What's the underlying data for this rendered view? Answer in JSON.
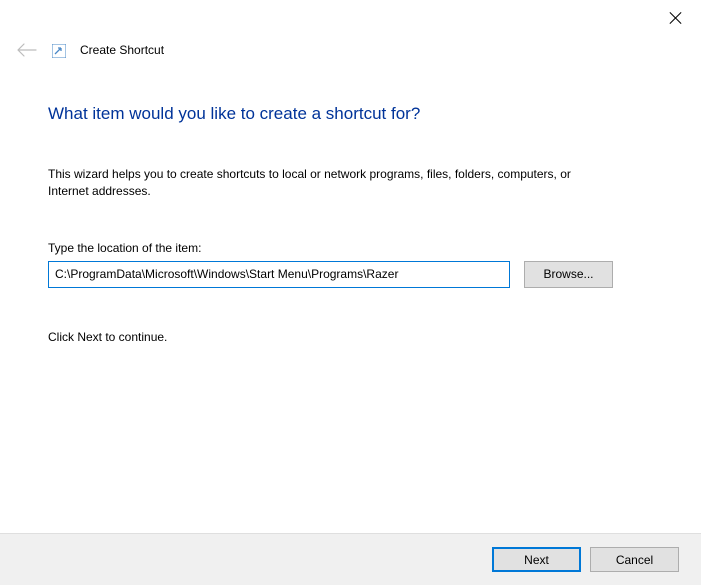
{
  "titlebar": {
    "close": "Close"
  },
  "header": {
    "title": "Create Shortcut"
  },
  "content": {
    "heading": "What item would you like to create a shortcut for?",
    "intro": "This wizard helps you to create shortcuts to local or network programs, files, folders, computers, or Internet addresses.",
    "field_label": "Type the location of the item:",
    "location_value": "C:\\ProgramData\\Microsoft\\Windows\\Start Menu\\Programs\\Razer",
    "browse_label": "Browse...",
    "continue_text": "Click Next to continue."
  },
  "footer": {
    "next_label": "Next",
    "cancel_label": "Cancel"
  }
}
